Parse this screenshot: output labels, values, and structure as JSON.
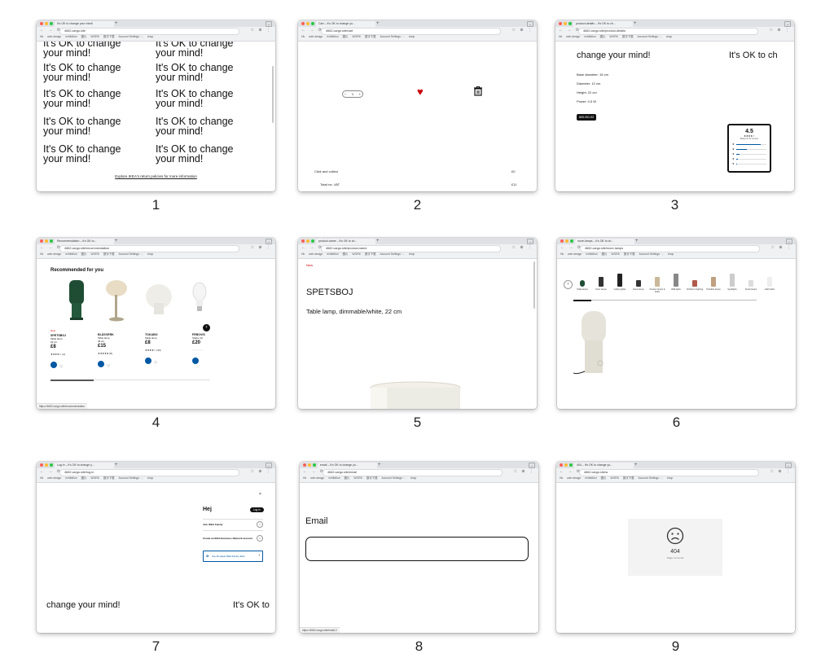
{
  "chrome": {
    "accent_colors": {
      "close": "#ff5f57",
      "min": "#febc2e",
      "max": "#28c840"
    },
    "nav_icons": "← → ⟳",
    "bookmarks": [
      "Hk",
      "web design",
      "exhibition",
      "图片",
      "WORK",
      "数字下载",
      "Account Settings ·...",
      "shop"
    ]
  },
  "screens": [
    {
      "caption": "1",
      "tab": "It's OK to change your mind!",
      "url": "4662.cargo.site",
      "phrases": [
        "It's OK to change your mind!",
        "It's OK to change your mind!",
        "It's OK to change your mind!",
        "It's OK to change your mind!",
        "It's OK to change your mind!",
        "It's OK to change your mind!",
        "It's OK to change your mind!",
        "It's OK to change your mind!",
        "It's OK to change your mind!",
        "It's OK to change your mind!"
      ],
      "footer_link": "Explore IKEA's return policies for more information"
    },
    {
      "caption": "2",
      "tab": "Cart – It's OK to change yo...",
      "url": "4662.cargo.site/cart",
      "qty": "1",
      "rows": [
        {
          "label": "Click and collect",
          "value": "£0"
        },
        {
          "label": "Total inc. VAT",
          "value": "£11"
        }
      ]
    },
    {
      "caption": "3",
      "tab": "product-details – It's OK to ch...",
      "url": "4662.cargo.site/product-details",
      "marquee_left": "change your mind!",
      "marquee_right": "It's OK to ch",
      "specs": [
        "Base diameter: 15 cm",
        "Diameter: 12 cm",
        "Height: 22 cm",
        "Power: 4.5 W"
      ],
      "code": "805.091.53",
      "rating": "4.5",
      "rating_sub": "Based on 52 reviews",
      "rating_bars": [
        0.82,
        0.35,
        0.12,
        0.05,
        0.03
      ]
    },
    {
      "caption": "4",
      "tab": "Recommendation – It's OK to...",
      "url": "4662.cargo.site/recommendation",
      "heading": "Recommended for you",
      "products": [
        {
          "badge": "New",
          "name": "SPETSBOJ",
          "desc": "Table lamp",
          "desc2": "22 cm",
          "price": "£8",
          "stars": "★★★★☆",
          "reviews": "(4)"
        },
        {
          "badge": "",
          "name": "BLÅSVERK",
          "desc": "Table lamp",
          "desc2": "36 cm",
          "price": "£15",
          "stars": "★★★★★",
          "reviews": "(8)"
        },
        {
          "badge": "",
          "name": "TOKABO",
          "desc": "Table lamp",
          "desc2": "",
          "price": "£8",
          "stars": "★★★★☆",
          "reviews": "(33)"
        },
        {
          "badge": "",
          "name": "FEBOVIS",
          "desc": "Starter kit",
          "desc2": "",
          "price": "£20",
          "stars": "☆☆☆☆☆",
          "reviews": ""
        }
      ],
      "status": "https://4662.cargo.site/recommendation"
    },
    {
      "caption": "5",
      "tab": "product-name – It's OK to ch...",
      "url": "4662.cargo.site/product-name",
      "badge": "New",
      "name": "SPETSBOJ",
      "desc": "Table lamp, dimmable/white, 22 cm"
    },
    {
      "caption": "6",
      "tab": "more-lamps – It's OK to ch...",
      "url": "4662.cargo.site/more-lamps",
      "categories": [
        "Table lamps",
        "Floor lamps",
        "Ceiling lights",
        "Desk lamps",
        "Smarter lamps & bulbs",
        "Wall lights",
        "Children's lighting",
        "Portable lamps",
        "Spotlights",
        "Smart lamps",
        "LED bulbs"
      ]
    },
    {
      "caption": "7",
      "tab": "Log in – It's OK to change y...",
      "url": "4662.cargo.site/log-in",
      "hej": "Hej",
      "login_btn": "Log in",
      "menu": [
        "Join IKEA Family",
        "Create an IKEA Business Network account"
      ],
      "banner": "Use the latest IKEA Family offers",
      "marquee_left": "change your mind!",
      "marquee_right": "It's OK to"
    },
    {
      "caption": "8",
      "tab": "email – It's OK to change yo...",
      "url": "4662.cargo.site/email",
      "label": "Email",
      "status": "https://4662.cargo.site/email-2"
    },
    {
      "caption": "9",
      "tab": "404 – It's OK to change yo...",
      "url": "4662.cargo.site/a",
      "code": "404",
      "msg": "Page not found"
    }
  ]
}
